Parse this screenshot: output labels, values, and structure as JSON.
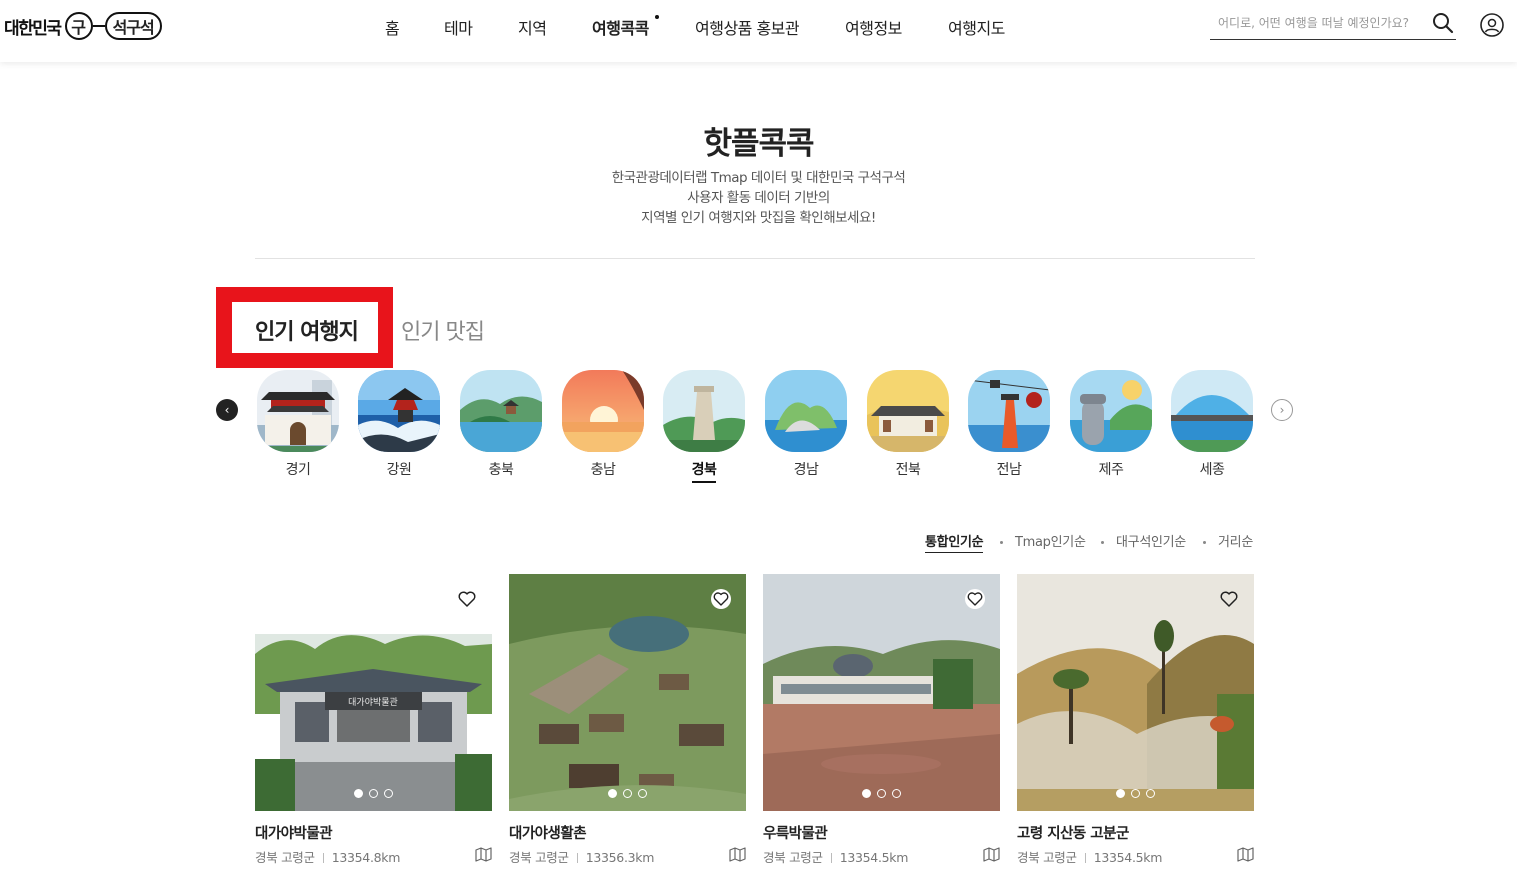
{
  "header": {
    "logo_text": "대한민국",
    "logo_circle": "구",
    "logo_pill": "석구석",
    "nav": [
      {
        "label": "홈",
        "active": false
      },
      {
        "label": "테마",
        "active": false
      },
      {
        "label": "지역",
        "active": false
      },
      {
        "label": "여행콕콕",
        "active": true
      },
      {
        "label": "여행상품 홍보관",
        "active": false
      },
      {
        "label": "여행정보",
        "active": false
      },
      {
        "label": "여행지도",
        "active": false
      }
    ],
    "search_placeholder": "어디로, 어떤 여행을 떠날 예정인가요?"
  },
  "main": {
    "title": "핫플콕콕",
    "desc": [
      "한국관광데이터랩 Tmap 데이터 및 대한민국 구석구석",
      "사용자 활동 데이터 기반의",
      "지역별 인기 여행지와 맛집을 확인해보세요!"
    ],
    "tabs": [
      {
        "label": "인기 여행지",
        "active": true
      },
      {
        "label": "인기 맛집",
        "active": false
      }
    ],
    "regions": [
      {
        "label": "경기",
        "active": false
      },
      {
        "label": "강원",
        "active": false
      },
      {
        "label": "충북",
        "active": false
      },
      {
        "label": "충남",
        "active": false
      },
      {
        "label": "경북",
        "active": true
      },
      {
        "label": "경남",
        "active": false
      },
      {
        "label": "전북",
        "active": false
      },
      {
        "label": "전남",
        "active": false
      },
      {
        "label": "제주",
        "active": false
      },
      {
        "label": "세종",
        "active": false
      }
    ],
    "sort": [
      {
        "label": "통합인기순",
        "active": true
      },
      {
        "label": "Tmap인기순",
        "active": false
      },
      {
        "label": "대구석인기순",
        "active": false
      },
      {
        "label": "거리순",
        "active": false
      }
    ],
    "cards": [
      {
        "title": "대가야박물관",
        "region": "경북 고령군",
        "distance": "13354.8km",
        "sign": "대가야박물관"
      },
      {
        "title": "대가야생활촌",
        "region": "경북 고령군",
        "distance": "13356.3km"
      },
      {
        "title": "우륵박물관",
        "region": "경북 고령군",
        "distance": "13354.5km"
      },
      {
        "title": "고령 지산동 고분군",
        "region": "경북 고령군",
        "distance": "13354.5km"
      }
    ]
  },
  "colors": {
    "highlight": "#e8141b",
    "text": "#222222",
    "muted": "#888888"
  }
}
